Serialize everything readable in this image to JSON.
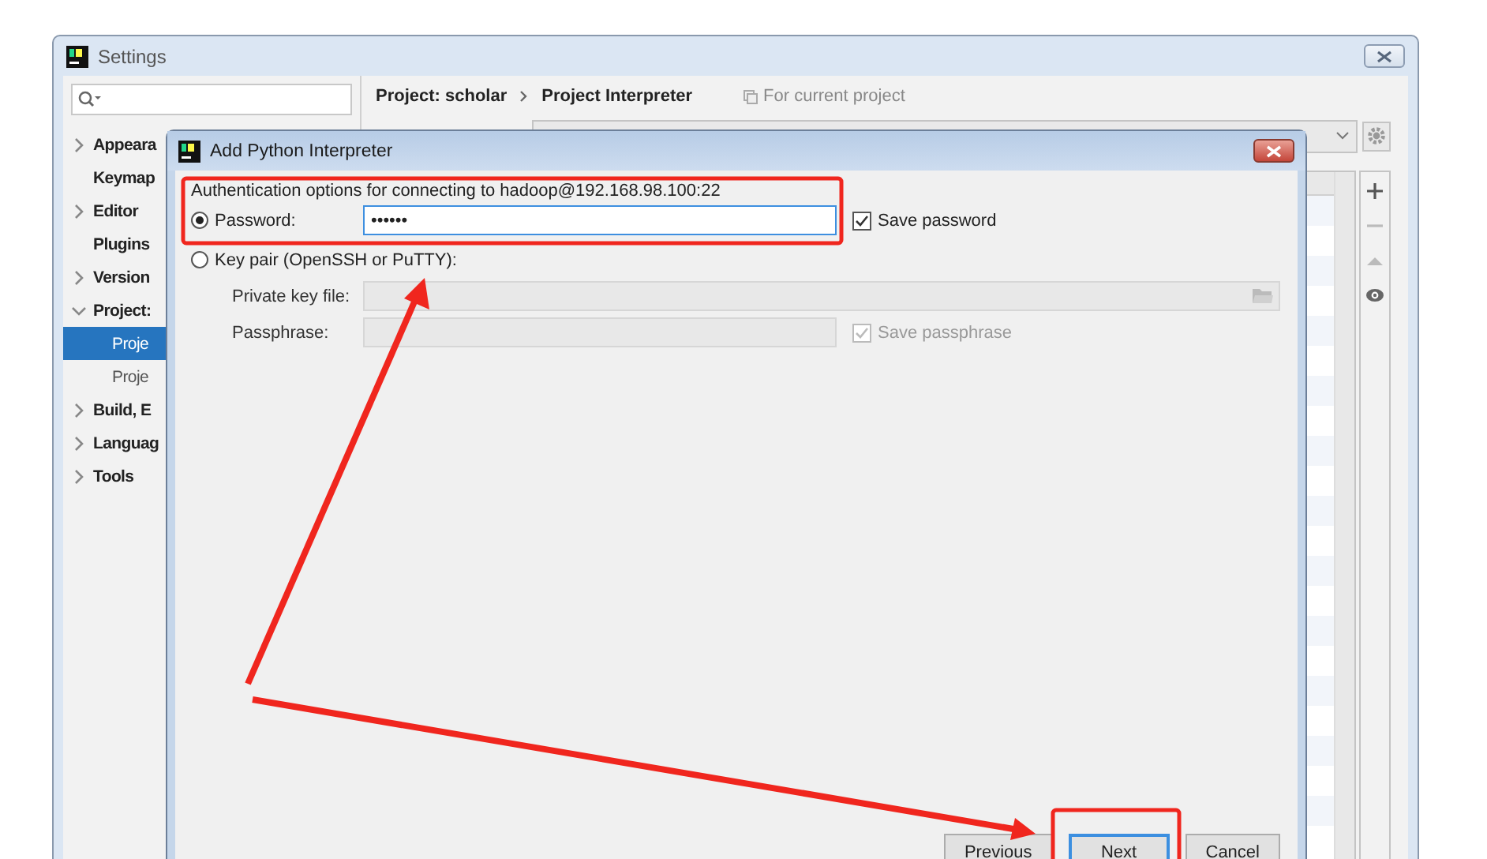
{
  "settings_window": {
    "title": "Settings",
    "sidebar": {
      "items": [
        {
          "label": "Appeara",
          "kind": "group",
          "expanded": false,
          "selected": false
        },
        {
          "label": "Keymap",
          "kind": "page",
          "selected": false
        },
        {
          "label": "Editor",
          "kind": "group",
          "expanded": false,
          "selected": false
        },
        {
          "label": "Plugins",
          "kind": "page",
          "selected": false
        },
        {
          "label": "Version",
          "kind": "group",
          "expanded": false,
          "selected": false
        },
        {
          "label": "Project:",
          "kind": "group",
          "expanded": true,
          "selected": false,
          "children": [
            {
              "label": "Proje",
              "selected": true
            },
            {
              "label": "Proje",
              "selected": false
            }
          ]
        },
        {
          "label": "Build, E",
          "kind": "group",
          "expanded": false,
          "selected": false
        },
        {
          "label": "Languag",
          "kind": "group",
          "expanded": false,
          "selected": false
        },
        {
          "label": "Tools",
          "kind": "group",
          "expanded": false,
          "selected": false
        }
      ]
    },
    "breadcrumb": [
      "Project: scholar",
      "Project Interpreter"
    ],
    "scope_note": "For current project"
  },
  "dialog": {
    "title": "Add Python Interpreter",
    "heading": "Authentication options for connecting to hadoop@192.168.98.100:22",
    "auth_options": [
      {
        "label": "Password:",
        "selected": true
      },
      {
        "label": "Key pair (OpenSSH or PuTTY):",
        "selected": false
      }
    ],
    "password_field": {
      "value": "••••••"
    },
    "save_password": {
      "label": "Save password",
      "checked": true,
      "disabled": false
    },
    "private_key_field": {
      "label": "Private key file:",
      "disabled": true
    },
    "passphrase_field": {
      "label": "Passphrase:",
      "disabled": true
    },
    "save_passphrase": {
      "label": "Save passphrase",
      "checked": true,
      "disabled": true
    },
    "buttons": [
      {
        "label": "Previous",
        "default": false
      },
      {
        "label": "Next",
        "default": true
      },
      {
        "label": "Cancel",
        "default": false
      }
    ]
  }
}
